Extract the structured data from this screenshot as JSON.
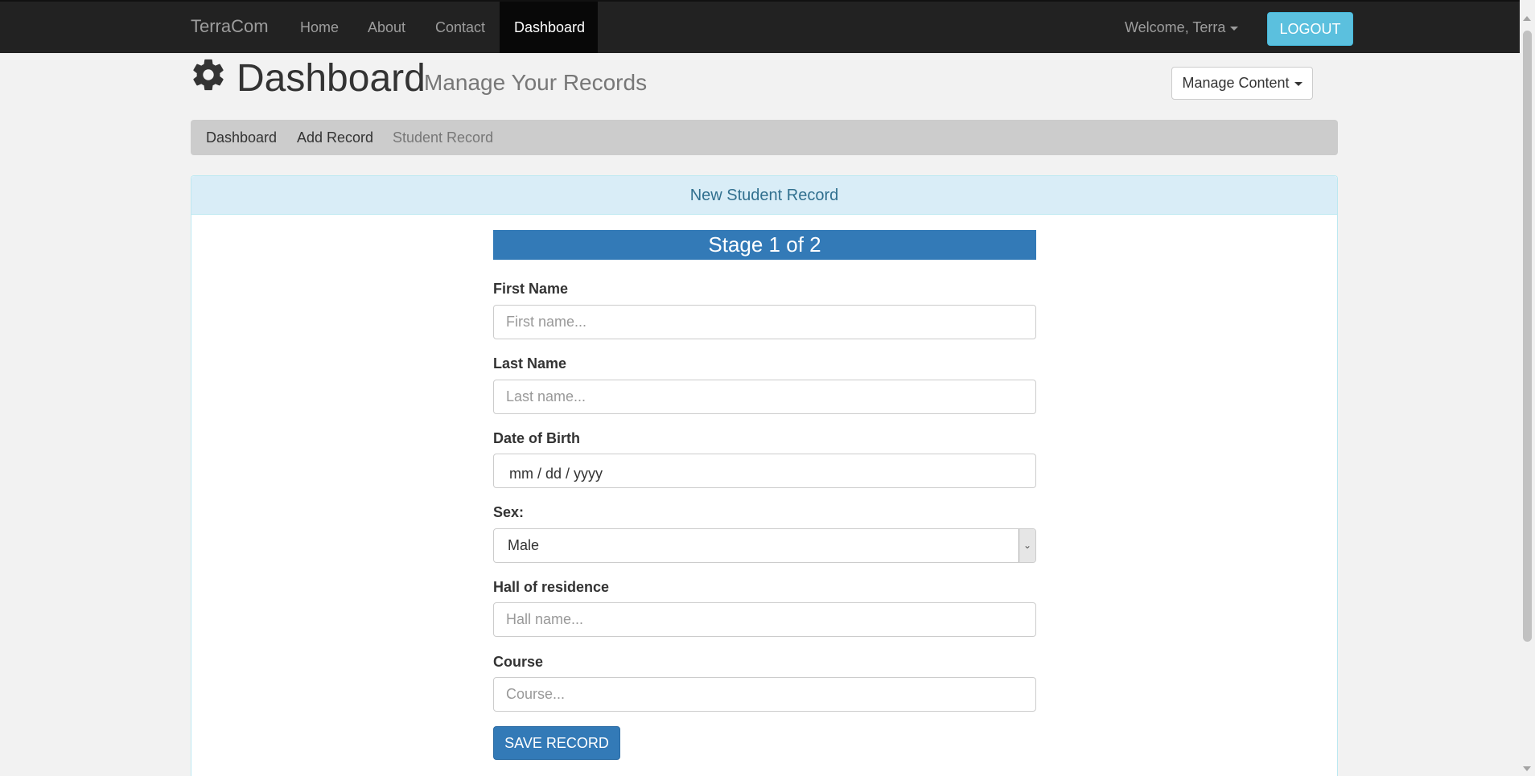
{
  "navbar": {
    "brand": "TerraCom",
    "links": [
      "Home",
      "About",
      "Contact",
      "Dashboard"
    ],
    "active_link": "Dashboard",
    "welcome": "Welcome, Terra",
    "logout_label": "LOGOUT"
  },
  "header": {
    "title": "Dashboard",
    "subtitle": "Manage Your Records",
    "manage_content_label": "Manage Content",
    "icon": "gear-icon"
  },
  "breadcrumb": {
    "items": [
      "Dashboard",
      "Add Record",
      "Student Record"
    ]
  },
  "panel": {
    "heading": "New Student Record",
    "stage": "Stage 1 of 2"
  },
  "form": {
    "first_name": {
      "label": "First Name",
      "placeholder": "First name...",
      "value": ""
    },
    "last_name": {
      "label": "Last Name",
      "placeholder": "Last name...",
      "value": ""
    },
    "dob": {
      "label": "Date of Birth",
      "value": "mm / dd / yyyy"
    },
    "sex": {
      "label": "Sex:",
      "value": "Male"
    },
    "hall": {
      "label": "Hall of residence",
      "placeholder": "Hall name...",
      "value": ""
    },
    "course": {
      "label": "Course",
      "placeholder": "Course...",
      "value": ""
    },
    "save_label": "SAVE RECORD"
  },
  "colors": {
    "navbar_bg": "#222222",
    "logout_bg": "#5bc0de",
    "primary": "#337ab7",
    "panel_heading_bg": "#d9edf7",
    "panel_heading_text": "#31708f"
  }
}
